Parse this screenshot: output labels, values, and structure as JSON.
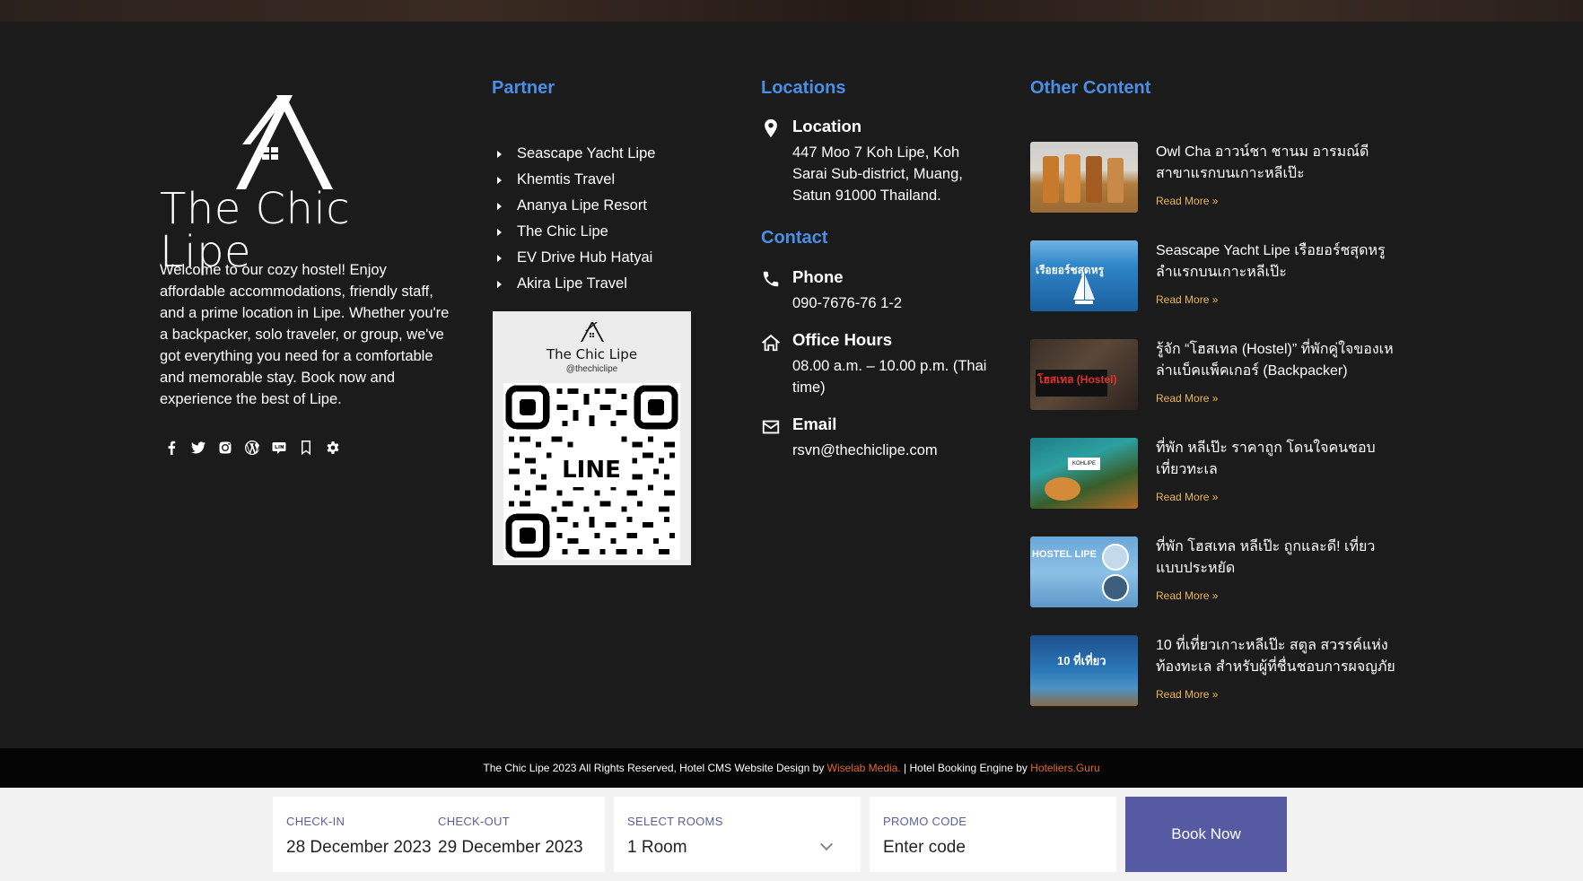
{
  "brand": {
    "name": "The Chic Lipe",
    "about": "Welcome to our cozy hostel! Enjoy affordable accommodations, friendly staff, and a prime location in Lipe. Whether you're a backpacker, solo traveler, or group, we've got everything you need for a comfortable and memorable stay. Book now and experience the best of Lipe.",
    "socials": [
      "facebook-icon",
      "twitter-icon",
      "instagram-icon",
      "wordpress-icon",
      "line-icon",
      "bookmark-icon",
      "gear-icon"
    ]
  },
  "partner": {
    "title": "Partner",
    "items": [
      "Seascape Yacht Lipe",
      "Khemtis Travel",
      "Ananya Lipe Resort",
      "The Chic Lipe",
      "EV Drive Hub Hatyai",
      "Akira Lipe Travel"
    ],
    "qr": {
      "name": "The Chic Lipe",
      "handle": "@thechiclipe",
      "label": "LINE"
    }
  },
  "locations": {
    "title": "Locations",
    "location_label": "Location",
    "location_value": "447 Moo 7 Koh Lipe, Koh Sarai Sub-district, Muang, Satun 91000 Thailand.",
    "contact_title": "Contact",
    "phone_label": "Phone",
    "phone_value": "090-7676-76 1-2",
    "hours_label": "Office Hours",
    "hours_value": "08.00 a.m. – 10.00 p.m. (Thai time)",
    "email_label": "Email",
    "email_value": "rsvn@thechiclipe.com"
  },
  "other": {
    "title": "Other Content",
    "read_more": "Read More »",
    "posts": [
      {
        "title": "Owl Cha อาวน์ชา ชานม อารมณ์ดี สาขาแรกบนเกาะหลีเป๊ะ"
      },
      {
        "title": "Seascape Yacht Lipe เรือยอร์ชสุดหรู ลำแรกบนเกาะหลีเป๊ะ"
      },
      {
        "title": "รู้จัก “โฮสเทล (Hostel)” ที่พักคู่ใจของเหล่าแบ็คแพ็คเกอร์ (Backpacker)"
      },
      {
        "title": "ที่พัก หลีเป๊ะ ราคาถูก โดนใจคนชอบเที่ยวทะเล"
      },
      {
        "title": "ที่พัก โฮสเทล หลีเป๊ะ ถูกและดี! เที่ยวแบบประหยัด"
      },
      {
        "title": "10 ที่เที่ยวเกาะหลีเป๊ะ สตูล สวรรค์แห่งท้องทะเล สำหรับผู้ที่ชื่นชอบการผจญภัย"
      }
    ],
    "thumb_texts": [
      "",
      "เรือยอร์ชสุดหรู",
      "โฮสเทล (Hostel)",
      "KOHLIPE",
      "HOSTEL LIPE",
      "10 ที่เที่ยว"
    ]
  },
  "copyright": {
    "text": "The Chic Lipe 2023 All Rights Reserved, Hotel CMS Website Design by ",
    "link1": "Wiselab Media.",
    "middle": " | Hotel Booking Engine by ",
    "link2": "Hoteliers.Guru"
  },
  "booking": {
    "checkin_label": "CHECK-IN",
    "checkin_value": "28 December 2023",
    "checkout_label": "CHECK-OUT",
    "checkout_value": "29 December 2023",
    "rooms_label": "SELECT ROOMS",
    "rooms_value": "1 Room",
    "promo_label": "PROMO CODE",
    "promo_placeholder": "Enter code",
    "book_label": "Book Now"
  }
}
